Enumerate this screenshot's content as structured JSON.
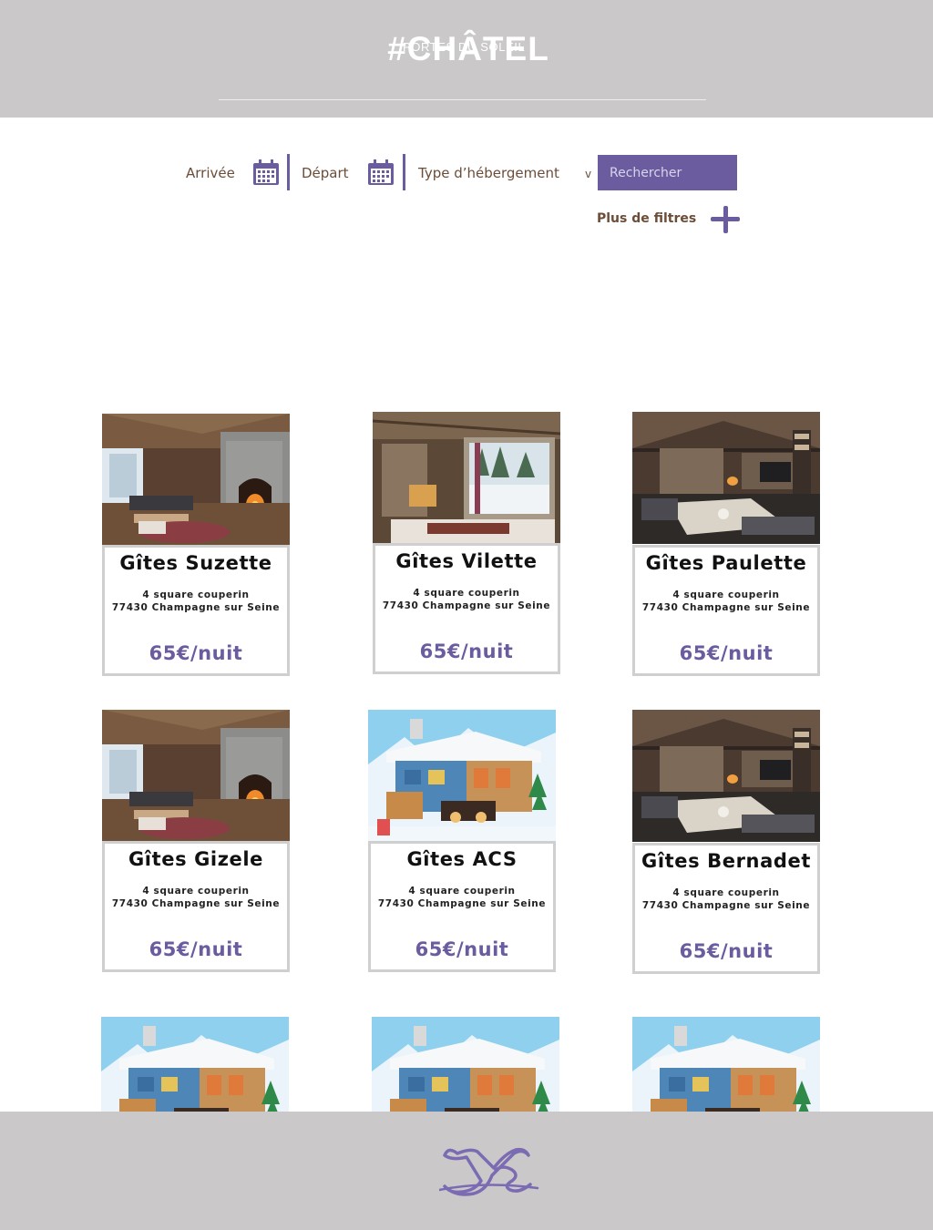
{
  "header": {
    "logo_main": "#CHÂTEL",
    "logo_sub": "PORTES DU SOLEIL"
  },
  "search": {
    "arrival_label": "Arrivée",
    "departure_label": "Départ",
    "type_label": "Type d’hébergement",
    "type_chevron": "v",
    "search_button": "Rechercher",
    "more_filters": "Plus de filtres"
  },
  "listings": [
    {
      "title": "Gîtes Suzette",
      "address_line1": "4 square couperin",
      "address_line2": "77430 Champagne sur Seine",
      "price": "65€/nuit",
      "image": "chalet-fireplace-photo"
    },
    {
      "title": "Gîtes Vilette",
      "address_line1": "4 square couperin",
      "address_line2": "77430 Champagne sur Seine",
      "price": "65€/nuit",
      "image": "chalet-window-photo"
    },
    {
      "title": "Gîtes Paulette",
      "address_line1": "4 square couperin",
      "address_line2": "77430 Champagne sur Seine",
      "price": "65€/nuit",
      "image": "chalet-living-room-photo"
    },
    {
      "title": "Gîtes Gizele",
      "address_line1": "4 square couperin",
      "address_line2": "77430 Champagne sur Seine",
      "price": "65€/nuit",
      "image": "chalet-fireplace-photo"
    },
    {
      "title": "Gîtes ACS",
      "address_line1": "4 square couperin",
      "address_line2": "77430 Champagne sur Seine",
      "price": "65€/nuit",
      "image": "toy-ski-chalet-illustration"
    },
    {
      "title": "Gîtes Bernadet",
      "address_line1": "4 square couperin",
      "address_line2": "77430 Champagne sur Seine",
      "price": "65€/nuit",
      "image": "chalet-living-room-photo"
    },
    {
      "image": "toy-ski-chalet-illustration"
    },
    {
      "image": "toy-ski-chalet-illustration"
    },
    {
      "image": "toy-ski-chalet-illustration"
    }
  ],
  "footer": {
    "logo": "ys-monogram-logo"
  },
  "colors": {
    "header_bg": "#cac8c9",
    "accent": "#6a5c9e",
    "label_brown": "#6b4d38"
  }
}
